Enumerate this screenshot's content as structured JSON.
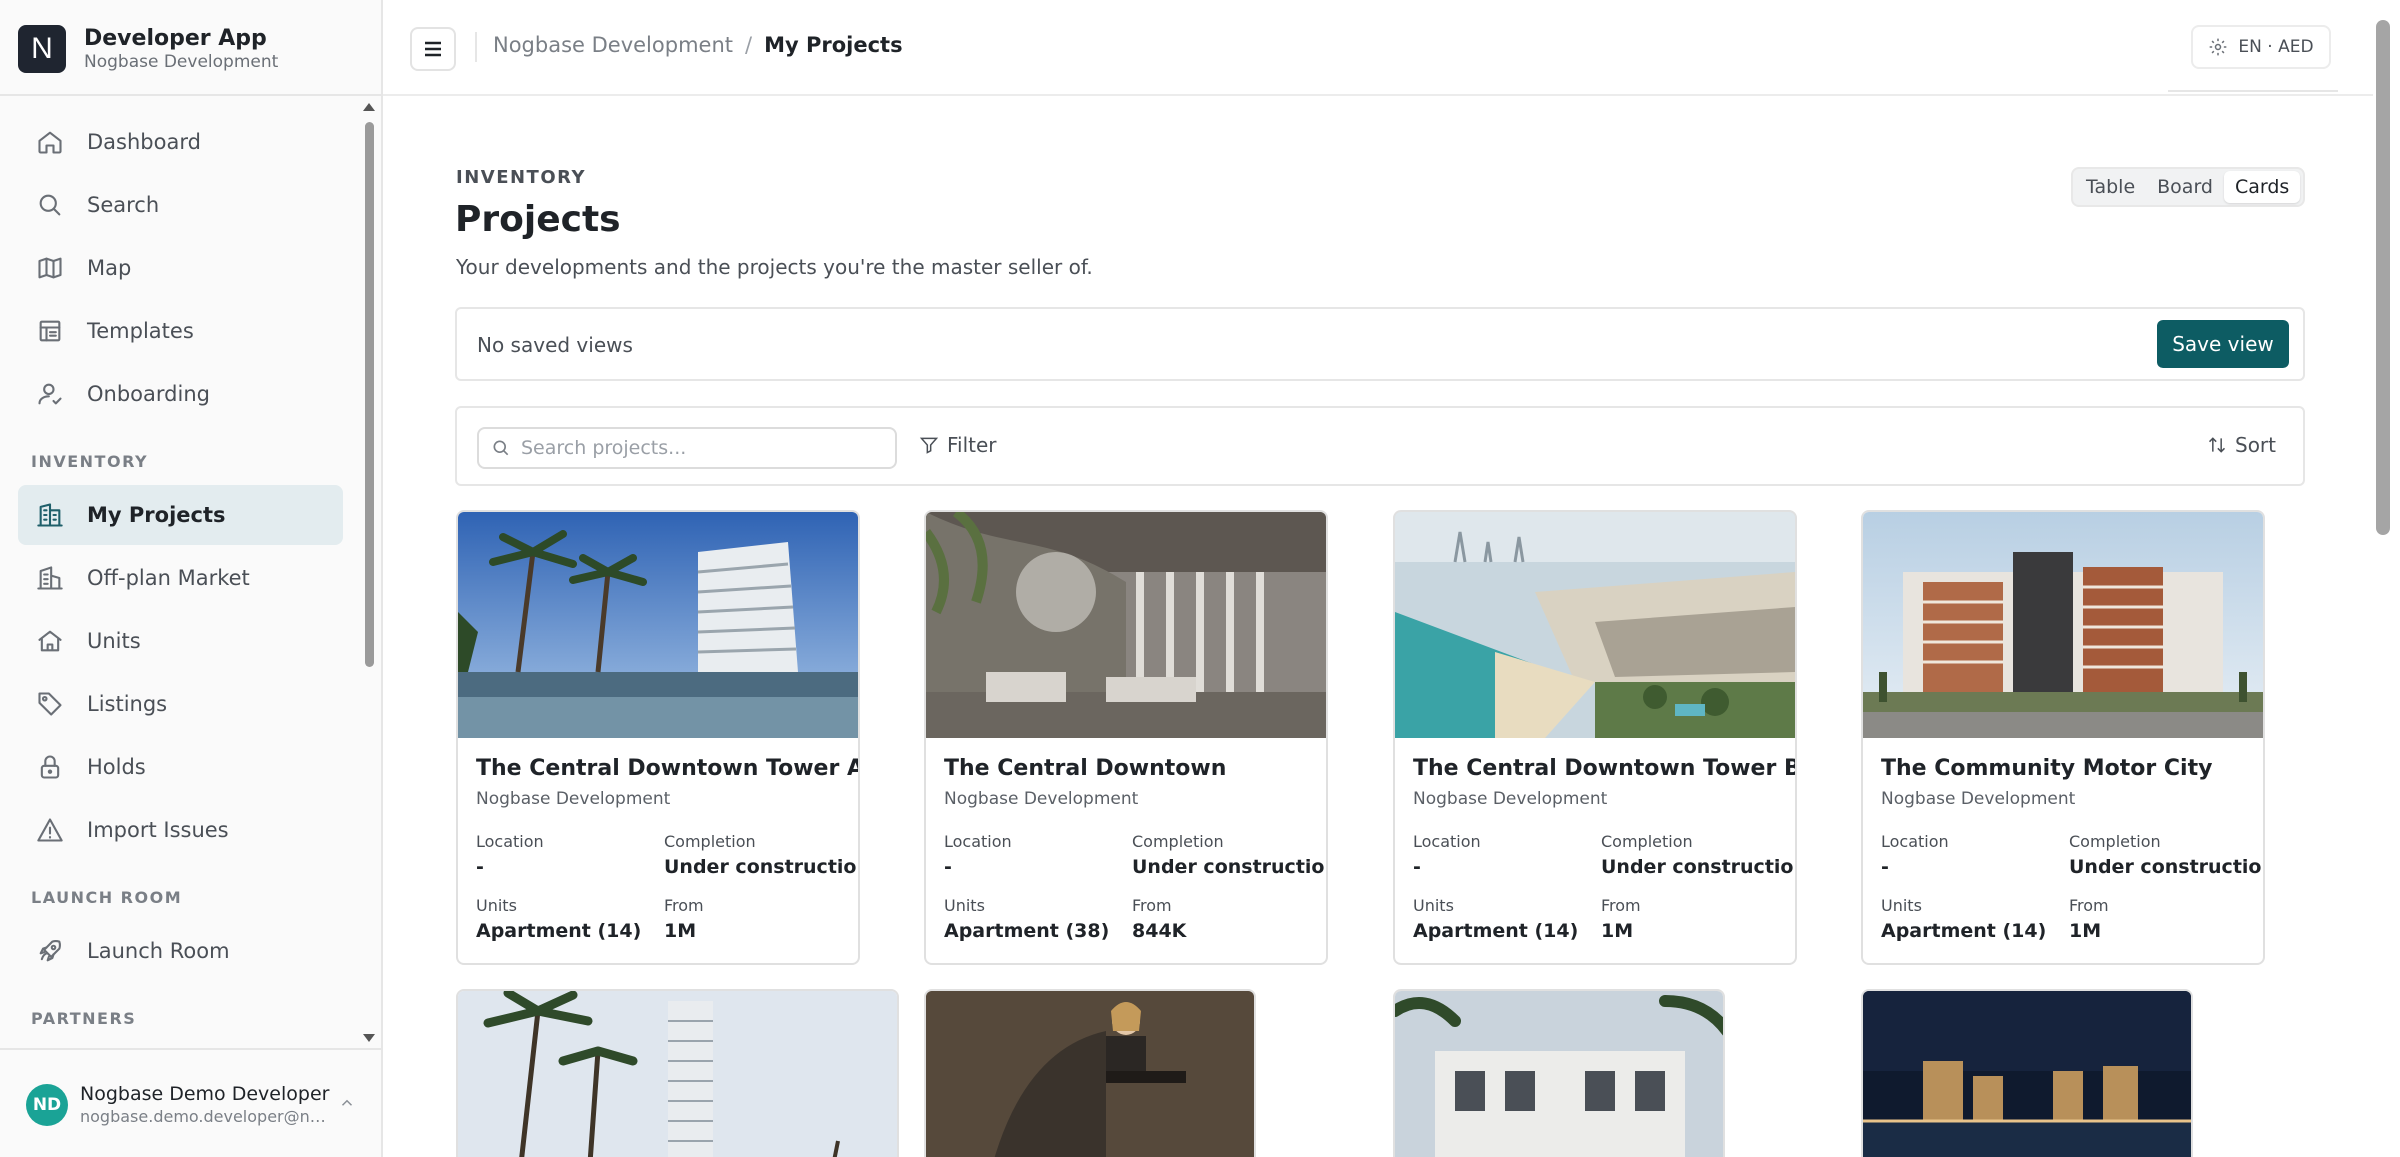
{
  "app": {
    "logo_letter": "N",
    "name": "Developer App",
    "org": "Nogbase Development"
  },
  "sidebar": {
    "items": [
      {
        "label": "Dashboard",
        "icon": "home-icon"
      },
      {
        "label": "Search",
        "icon": "search-icon"
      },
      {
        "label": "Map",
        "icon": "map-icon"
      },
      {
        "label": "Templates",
        "icon": "templates-icon"
      },
      {
        "label": "Onboarding",
        "icon": "onboarding-icon"
      }
    ],
    "inventory_section": "INVENTORY",
    "inventory_items": [
      {
        "label": "My Projects",
        "icon": "building-icon",
        "active": true
      },
      {
        "label": "Off-plan Market",
        "icon": "office-icon"
      },
      {
        "label": "Units",
        "icon": "house-icon"
      },
      {
        "label": "Listings",
        "icon": "tag-icon"
      },
      {
        "label": "Holds",
        "icon": "lock-icon"
      },
      {
        "label": "Import Issues",
        "icon": "warning-icon"
      }
    ],
    "launch_section": "LAUNCH ROOM",
    "launch_items": [
      {
        "label": "Launch Room",
        "icon": "rocket-icon"
      }
    ],
    "partners_section": "PARTNERS"
  },
  "user": {
    "initials": "ND",
    "name": "Nogbase Demo Developer",
    "email": "nogbase.demo.developer@nogbase.com"
  },
  "header": {
    "breadcrumb_parent": "Nogbase Development",
    "breadcrumb_sep": "/",
    "breadcrumb_current": "My Projects",
    "locale": "EN · AED"
  },
  "page": {
    "eyebrow": "INVENTORY",
    "title": "Projects",
    "subtitle": "Your developments and the projects you're the master seller of.",
    "views": [
      "Table",
      "Board",
      "Cards"
    ],
    "active_view": "Cards",
    "saved_views_label": "No saved views",
    "save_view_label": "Save view",
    "search_placeholder": "Search projects...",
    "filter_label": "Filter",
    "sort_label": "Sort"
  },
  "labels": {
    "location": "Location",
    "completion": "Completion",
    "units": "Units",
    "from": "From"
  },
  "projects": [
    {
      "name": "The Central Downtown Tower A",
      "developer": "Nogbase Development",
      "location": "-",
      "completion": "Under construction",
      "units": "Apartment (14)",
      "from": "1M"
    },
    {
      "name": "The Central Downtown",
      "developer": "Nogbase Development",
      "location": "-",
      "completion": "Under construction",
      "units": "Apartment (38)",
      "from": "844K"
    },
    {
      "name": "The Central Downtown Tower B",
      "developer": "Nogbase Development",
      "location": "-",
      "completion": "Under construction",
      "units": "Apartment (14)",
      "from": "1M"
    },
    {
      "name": "The Community Motor City",
      "developer": "Nogbase Development",
      "location": "-",
      "completion": "Under construction",
      "units": "Apartment (14)",
      "from": "1M"
    }
  ],
  "colors": {
    "primary": "#0d5c63",
    "active_nav_bg": "#e3ecef",
    "avatar": "#1aa396"
  }
}
